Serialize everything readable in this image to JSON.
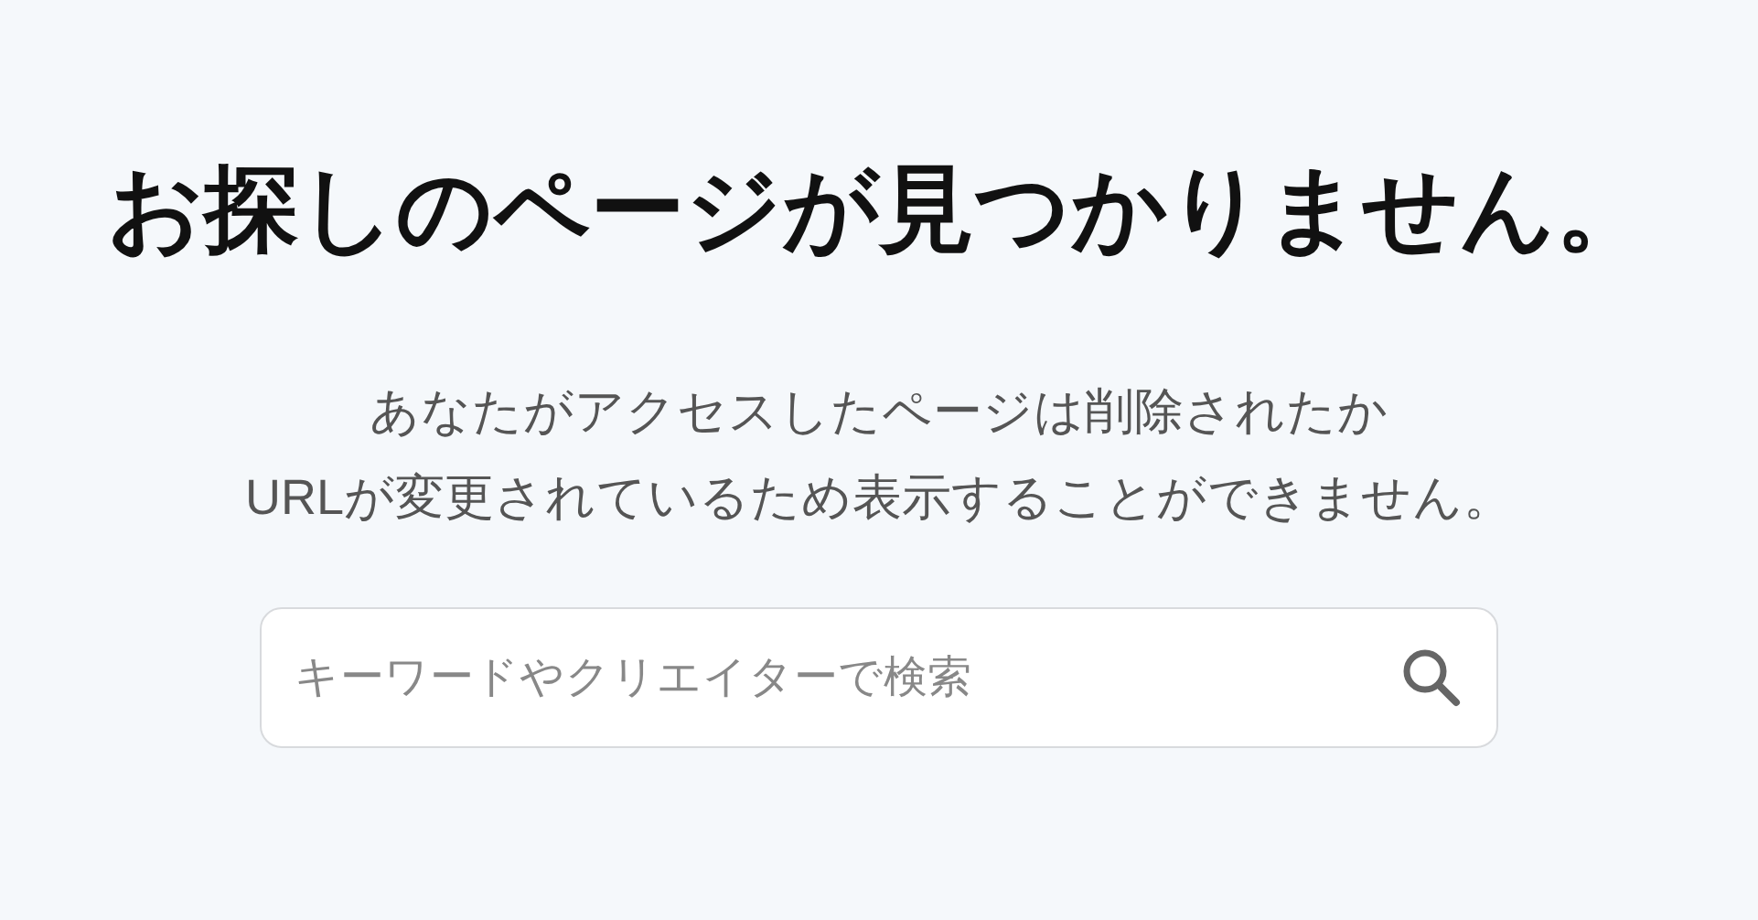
{
  "heading": "お探しのページが見つかりません。",
  "message_lines": [
    "あなたがアクセスしたページは削除されたか",
    "URLが変更されているため表示することができません。"
  ],
  "search": {
    "placeholder": "キーワードやクリエイターで検索"
  }
}
